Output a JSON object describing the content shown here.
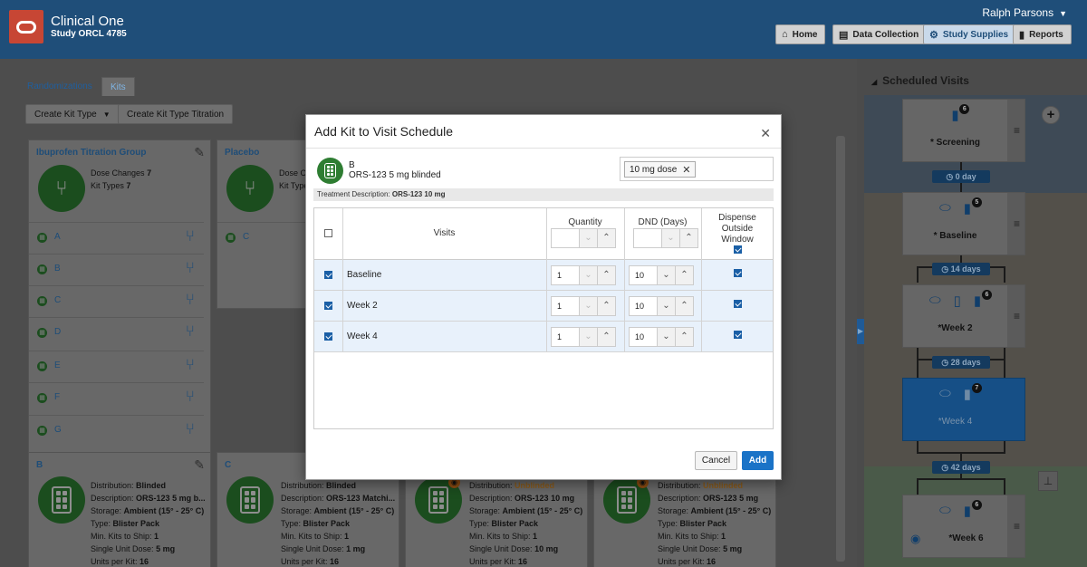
{
  "header": {
    "app_name": "Clinical One",
    "study_name": "Study ORCL 4785",
    "user_name": "Ralph Parsons",
    "nav": [
      {
        "label": "Home",
        "icon": "home-icon"
      },
      {
        "label": "Data Collection",
        "icon": "clipboard-icon"
      },
      {
        "label": "Study Supplies",
        "icon": "supplies-icon",
        "active": true
      },
      {
        "label": "Reports",
        "icon": "bar-chart-icon"
      }
    ]
  },
  "tabs": [
    "Randomizations",
    "Kits"
  ],
  "active_tab": "Kits",
  "toolbar": {
    "create_kit_type": "Create Kit Type",
    "create_kit_type_titration": "Create Kit Type Titration"
  },
  "titration_groups": [
    {
      "title": "Ibuprofen Titration Group",
      "dose_changes_label": "Dose Changes",
      "dose_changes": "7",
      "kit_types_label": "Kit Types",
      "kit_types": "7",
      "kits": [
        "A",
        "B",
        "C",
        "D",
        "E",
        "F",
        "G"
      ]
    },
    {
      "title": "Placebo",
      "dose_changes_label": "Dose Ch",
      "kit_types_label": "Kit Type",
      "kits": [
        "C"
      ]
    }
  ],
  "kit_cards": [
    {
      "title": "B",
      "distribution": "Blinded",
      "description": "ORS-123 5 mg b...",
      "storage": "Ambient (15° - 25° C)",
      "type": "Blister Pack",
      "min_kits": "1",
      "single_unit_dose": "5 mg",
      "units_per_kit": "16"
    },
    {
      "title": "C",
      "distribution": "Blinded",
      "description": "ORS-123 Matchi...",
      "storage": "Ambient (15° - 25° C)",
      "type": "Blister Pack",
      "min_kits": "1",
      "single_unit_dose": "1 mg",
      "units_per_kit": "16"
    },
    {
      "title": "",
      "distribution": "Unblinded",
      "description": "ORS-123 10 mg",
      "storage": "Ambient (15° - 25° C)",
      "type": "Blister Pack",
      "min_kits": "1",
      "single_unit_dose": "10 mg",
      "units_per_kit": "16"
    },
    {
      "title": "",
      "distribution": "Unblinded",
      "description": "ORS-123 5 mg",
      "storage": "Ambient (15° - 25° C)",
      "type": "Blister Pack",
      "min_kits": "1",
      "single_unit_dose": "5 mg",
      "units_per_kit": "16"
    }
  ],
  "card_labels": {
    "distribution": "Distribution:",
    "description": "Description:",
    "storage": "Storage:",
    "type": "Type:",
    "min_kits": "Min. Kits to Ship:",
    "single_unit_dose": "Single Unit Dose:",
    "units_per_kit": "Units per Kit:"
  },
  "scheduled_visits": {
    "title": "Scheduled Visits",
    "visits": [
      {
        "name": "* Screening",
        "badge": "6"
      },
      {
        "name": "* Baseline",
        "badge": "5"
      },
      {
        "name": "*Week 2",
        "badge": "6"
      },
      {
        "name": "*Week 4",
        "badge": "7",
        "selected": true
      },
      {
        "name": "*Week 6",
        "badge": "6"
      }
    ],
    "intervals": [
      "0 day",
      "14 days",
      "28 days",
      "42 days"
    ]
  },
  "modal": {
    "title": "Add Kit to Visit Schedule",
    "kit_name": "B",
    "kit_description": "ORS-123 5 mg blinded",
    "dose_tag": "10 mg dose",
    "treatment_label": "Treatment Description:",
    "treatment_value": "ORS-123 10 mg",
    "columns": {
      "visits": "Visits",
      "quantity": "Quantity",
      "dnd": "DND (Days)",
      "dispense_line1": "Dispense",
      "dispense_line2": "Outside",
      "dispense_line3": "Window"
    },
    "rows": [
      {
        "visit": "Baseline",
        "quantity": "1",
        "dnd": "10"
      },
      {
        "visit": "Week 2",
        "quantity": "1",
        "dnd": "10"
      },
      {
        "visit": "Week 4",
        "quantity": "1",
        "dnd": "10"
      }
    ],
    "cancel_label": "Cancel",
    "add_label": "Add"
  }
}
